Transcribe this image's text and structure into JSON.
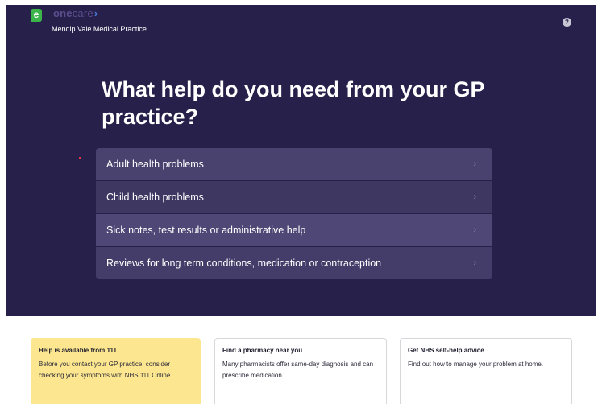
{
  "header": {
    "logo_letter": "e",
    "brand_one": "one",
    "brand_care": "care",
    "brand_chevron": "›",
    "practice_name": "Mendip Vale Medical Practice",
    "help_symbol": "?"
  },
  "main": {
    "headline": "What help do you need from your GP practice?",
    "options": [
      {
        "label": "Adult health problems",
        "arrow": "›"
      },
      {
        "label": "Child health problems",
        "arrow": "›"
      },
      {
        "label": "Sick notes, test results or administrative help",
        "arrow": "›"
      },
      {
        "label": "Reviews for long term conditions, medication or contraception",
        "arrow": "›"
      }
    ]
  },
  "cards": [
    {
      "title": "Help is available from 111",
      "text": "Before you contact your GP practice, consider checking your symptoms with NHS 111 Online."
    },
    {
      "title": "Find a pharmacy near you",
      "text": "Many pharmacists offer same-day diagnosis and can prescribe medication."
    },
    {
      "title": "Get NHS self-help advice",
      "text": "Find out how to manage your problem at home."
    }
  ],
  "colors": {
    "hero_bg": "#27204a",
    "logo_green": "#3bb54a",
    "notice_yellow": "#fce68f"
  }
}
